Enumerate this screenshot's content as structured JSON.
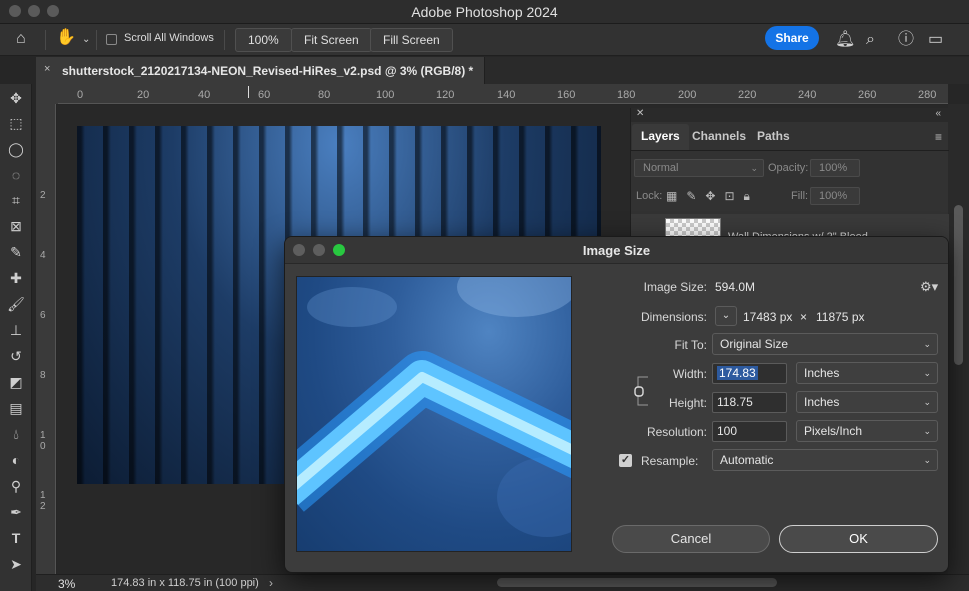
{
  "app": {
    "window_title": "Adobe Photoshop 2024"
  },
  "options_bar": {
    "scroll_all_windows_label": "Scroll All Windows",
    "zoom_100_label": "100%",
    "fit_screen_label": "Fit Screen",
    "fill_screen_label": "Fill Screen",
    "share_label": "Share"
  },
  "document": {
    "tab_title": "shutterstock_2120217134-NEON_Revised-HiRes_v2.psd @ 3% (RGB/8) *",
    "close_glyph": "×"
  },
  "rulers": {
    "horizontal": [
      "0",
      "20",
      "40",
      "60",
      "80",
      "100",
      "120",
      "140",
      "160",
      "180",
      "200",
      "220",
      "240",
      "260",
      "280"
    ],
    "vertical": [
      "2",
      "4",
      "6",
      "8",
      "1 0",
      "1 2"
    ]
  },
  "layers_panel": {
    "tabs": [
      "Layers",
      "Channels",
      "Paths"
    ],
    "blend_mode": "Normal",
    "opacity_label": "Opacity:",
    "opacity_value": "100%",
    "lock_label": "Lock:",
    "fill_label": "Fill:",
    "fill_value": "100%",
    "layer_name": "Wall Dimensions w/ 2\" Bleed"
  },
  "status_bar": {
    "zoom": "3%",
    "info": "174.83 in x 118.75 in (100 ppi)"
  },
  "image_size_dialog": {
    "title": "Image Size",
    "image_size_label": "Image Size:",
    "image_size_value": "594.0M",
    "dimensions_label": "Dimensions:",
    "dimensions_width": "17483 px",
    "dimensions_times": "×",
    "dimensions_height": "11875 px",
    "fit_to_label": "Fit To:",
    "fit_to_value": "Original Size",
    "width_label": "Width:",
    "width_value": "174.83",
    "width_unit": "Inches",
    "height_label": "Height:",
    "height_value": "118.75",
    "height_unit": "Inches",
    "resolution_label": "Resolution:",
    "resolution_value": "100",
    "resolution_unit": "Pixels/Inch",
    "resample_label": "Resample:",
    "resample_checked": true,
    "resample_value": "Automatic",
    "cancel_label": "Cancel",
    "ok_label": "OK"
  },
  "colors": {
    "accent_blue": "#1473e6",
    "selection_blue": "#2d5a9f",
    "zoom_green": "#28c840"
  }
}
